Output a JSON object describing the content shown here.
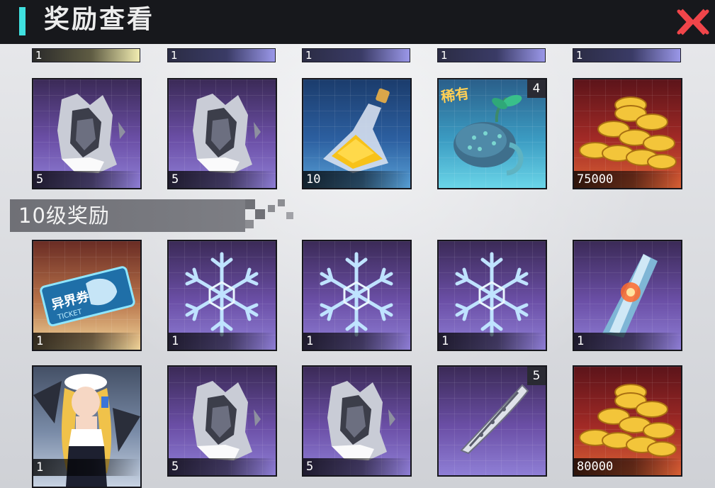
{
  "header": {
    "title": "奖励查看",
    "close_icon": "close-x-icon",
    "accent_color": "#3fe0df",
    "close_color": "#f0454a"
  },
  "top_strip": [
    {
      "count": "1"
    },
    {
      "count": "1"
    },
    {
      "count": "1"
    },
    {
      "count": "1"
    },
    {
      "count": "1"
    }
  ],
  "row1": [
    {
      "icon": "crystal-shard-icon",
      "count": "5"
    },
    {
      "icon": "crystal-shard-icon",
      "count": "5"
    },
    {
      "icon": "potion-bottle-icon",
      "count": "10"
    },
    {
      "icon": "seed-sprout-icon",
      "count": "",
      "badge": "稀有",
      "corner": "4"
    },
    {
      "icon": "gold-coins-icon",
      "count": "75000"
    }
  ],
  "section": {
    "label": "10级奖励"
  },
  "row2": [
    {
      "icon": "ticket-icon",
      "count": "1",
      "ticket_text": "异界券",
      "ticket_sub": "TICKET"
    },
    {
      "icon": "snowflake-icon",
      "count": "1"
    },
    {
      "icon": "snowflake-icon",
      "count": "1"
    },
    {
      "icon": "snowflake-icon",
      "count": "1"
    },
    {
      "icon": "red-crystal-icon",
      "count": "1"
    }
  ],
  "row3": [
    {
      "icon": "character-portrait",
      "count": "1"
    },
    {
      "icon": "crystal-shard-icon",
      "count": "5"
    },
    {
      "icon": "crystal-shard-icon",
      "count": "5"
    },
    {
      "icon": "blade-fragment-icon",
      "count": "",
      "corner": "5"
    },
    {
      "icon": "gold-coins-icon",
      "count": "80000"
    }
  ]
}
